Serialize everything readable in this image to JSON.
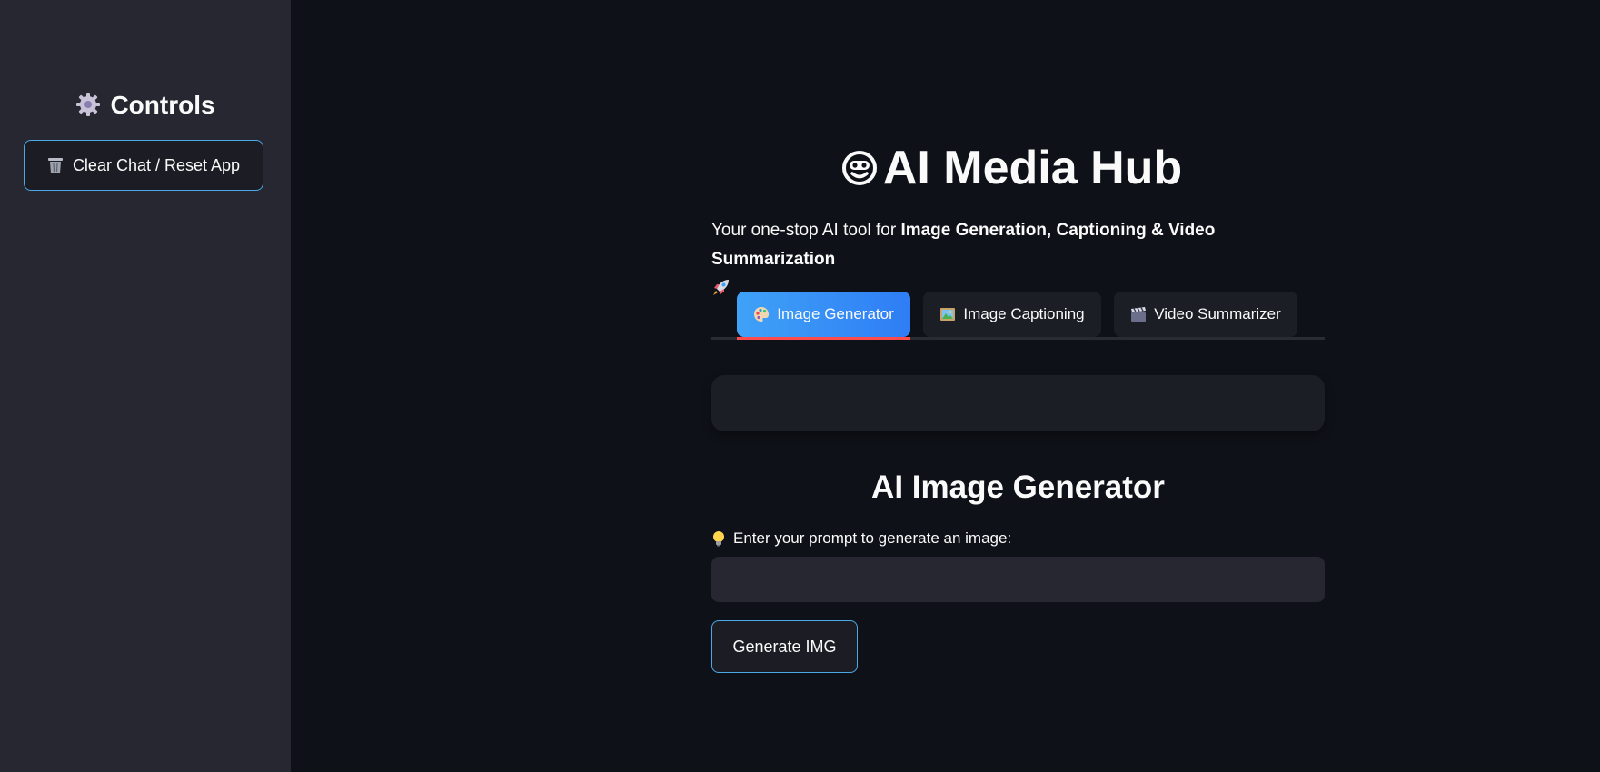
{
  "sidebar": {
    "title": "Controls",
    "title_icon": "gear-icon",
    "reset_button_label": "Clear Chat / Reset App",
    "reset_button_icon": "trash-icon"
  },
  "header": {
    "title": "AI Media Hub",
    "title_icon": "robot-face-icon",
    "subtitle_prefix": "Your one-stop AI tool for ",
    "subtitle_bold": "Image Generation, Captioning & Video Summarization",
    "subtitle_icon": "rocket-icon"
  },
  "tabs": [
    {
      "label": "Image Generator",
      "icon": "palette-icon",
      "active": true
    },
    {
      "label": "Image Captioning",
      "icon": "framed-picture-icon",
      "active": false
    },
    {
      "label": "Video Summarizer",
      "icon": "clapper-icon",
      "active": false
    }
  ],
  "generator": {
    "title": "AI Image Generator",
    "prompt_label": "Enter your prompt to generate an image:",
    "prompt_icon": "lightbulb-icon",
    "prompt_value": "",
    "prompt_placeholder": "",
    "button_label": "Generate IMG"
  },
  "colors": {
    "background": "#0e1117",
    "sidebar": "#262730",
    "accent_border": "#4aa8e6",
    "active_tab_start": "#3fa2f7",
    "active_tab_end": "#2f7df5",
    "active_tab_underline": "#ff4b4b"
  }
}
